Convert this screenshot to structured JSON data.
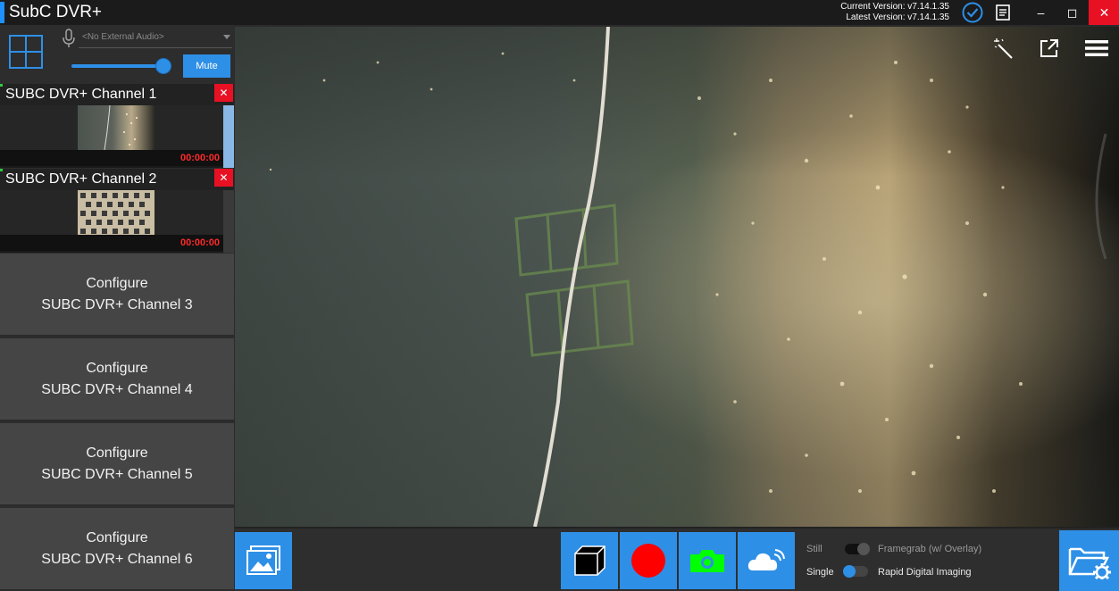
{
  "titlebar": {
    "app_title": "SubC DVR+",
    "current_version": "Current Version: v7.14.1.35",
    "latest_version": "Latest Version: v7.14.1.35",
    "minimize": "–",
    "maximize": "◻",
    "close": "✕"
  },
  "audio": {
    "source_placeholder": "<No External Audio>",
    "volume_percent": 100,
    "mute_label": "Mute"
  },
  "channels": [
    {
      "name": "SUBC DVR+ Channel 1",
      "timecode": "00:00:00",
      "close": "✕"
    },
    {
      "name": "SUBC DVR+ Channel 2",
      "timecode": "00:00:00",
      "close": "✕"
    }
  ],
  "configure_slots": [
    {
      "line1": "Configure",
      "line2": "SUBC DVR+ Channel 3"
    },
    {
      "line1": "Configure",
      "line2": "SUBC DVR+ Channel 4"
    },
    {
      "line1": "Configure",
      "line2": "SUBC DVR+ Channel 5"
    },
    {
      "line1": "Configure",
      "line2": "SUBC DVR+ Channel 6"
    }
  ],
  "capture_modes": {
    "still_label": "Still",
    "framegrab_label": "Framegrab (w/ Overlay)",
    "framegrab_on": false,
    "single_label": "Single",
    "rdi_label": "Rapid Digital Imaging",
    "rdi_on": true
  },
  "colors": {
    "accent": "#2e8fe6",
    "record": "#ff0000",
    "camera": "#00ff00",
    "close": "#e81123",
    "timecode": "#ff2a2a"
  }
}
